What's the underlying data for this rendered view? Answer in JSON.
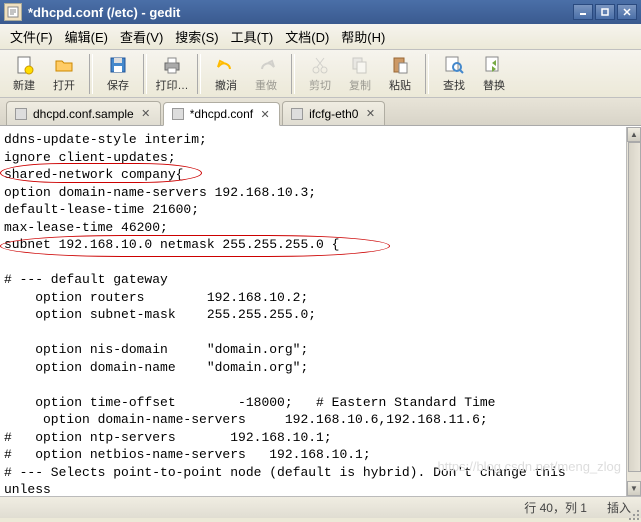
{
  "window": {
    "title": "*dhcpd.conf (/etc) - gedit"
  },
  "menu": {
    "file": "文件(F)",
    "edit": "编辑(E)",
    "view": "查看(V)",
    "search": "搜索(S)",
    "tools": "工具(T)",
    "docs": "文档(D)",
    "help": "帮助(H)"
  },
  "toolbar": {
    "new": "新建",
    "open": "打开",
    "save": "保存",
    "print": "打印…",
    "undo": "撤消",
    "redo": "重做",
    "cut": "剪切",
    "copy": "复制",
    "paste": "粘贴",
    "find": "查找",
    "replace": "替换"
  },
  "tabs": [
    {
      "label": "dhcpd.conf.sample"
    },
    {
      "label": "*dhcpd.conf"
    },
    {
      "label": "ifcfg-eth0"
    }
  ],
  "editor": {
    "content": "ddns-update-style interim;\nignore client-updates;\nshared-network company{\noption domain-name-servers 192.168.10.3;\ndefault-lease-time 21600;\nmax-lease-time 46200;\nsubnet 192.168.10.0 netmask 255.255.255.0 {\n\n# --- default gateway\n    option routers        192.168.10.2;\n    option subnet-mask    255.255.255.0;\n\n    option nis-domain     \"domain.org\";\n    option domain-name    \"domain.org\";\n\n    option time-offset        -18000;   # Eastern Standard Time\n     option domain-name-servers     192.168.10.6,192.168.11.6;\n#   option ntp-servers       192.168.10.1;\n#   option netbios-name-servers   192.168.10.1;\n# --- Selects point-to-point node (default is hybrid). Don't change this\nunless\n# -- you understand Netbios very well"
  },
  "status": {
    "position": "行 40，列 1",
    "mode": "插入"
  },
  "watermark": "https://blog.csdn.net/meng_zlog"
}
